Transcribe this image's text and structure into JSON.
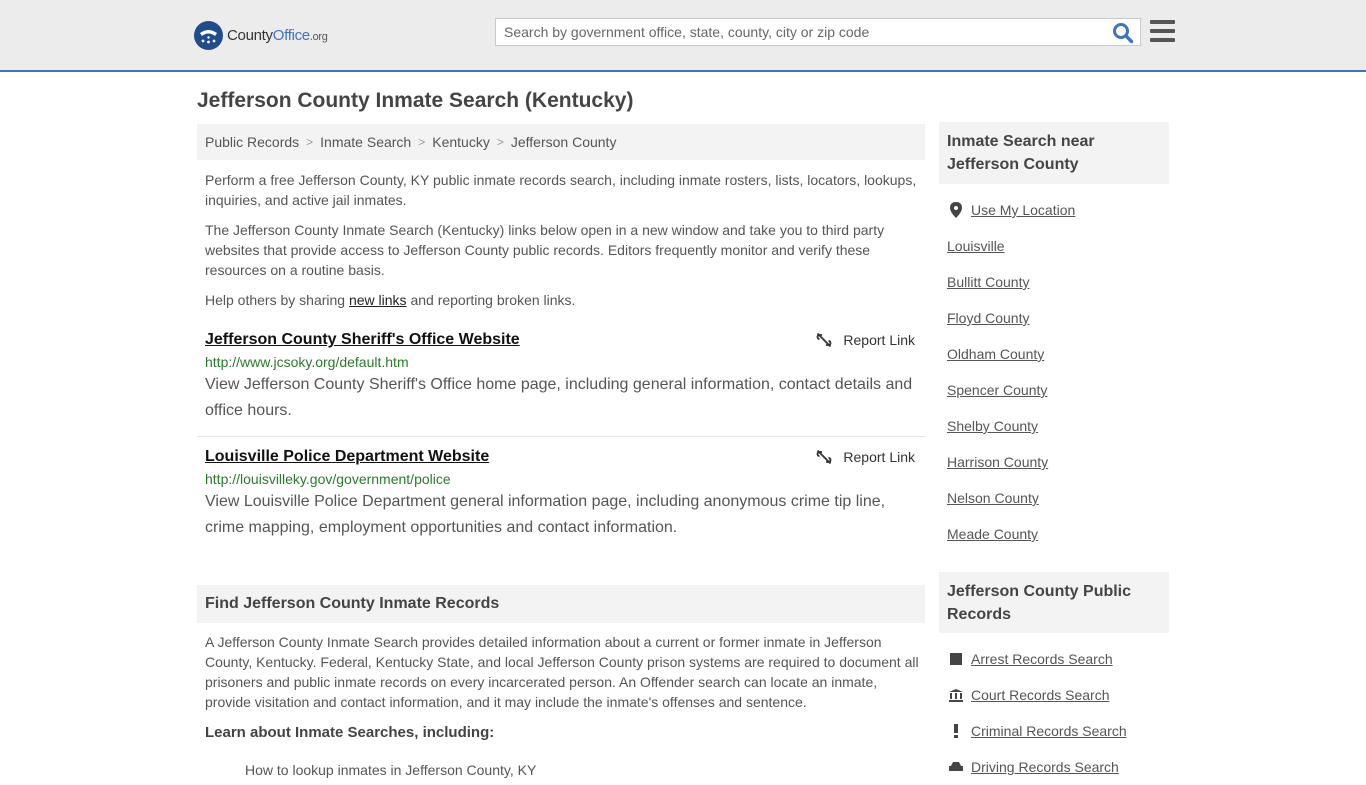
{
  "header": {
    "logo_prefix": "County",
    "logo_highlight": "Office",
    "logo_tld": ".org",
    "search_placeholder": "Search by government office, state, county, city or zip code"
  },
  "page": {
    "title": "Jefferson County Inmate Search (Kentucky)"
  },
  "breadcrumb": [
    "Public Records",
    "Inmate Search",
    "Kentucky",
    "Jefferson County"
  ],
  "intro": {
    "p1": "Perform a free Jefferson County, KY public inmate records search, including inmate rosters, lists, locators, lookups, inquiries, and active jail inmates.",
    "p2": "The Jefferson County Inmate Search (Kentucky) links below open in a new window and take you to third party websites that provide access to Jefferson County public records. Editors frequently monitor and verify these resources on a routine basis.",
    "p3_before": "Help others by sharing ",
    "p3_link": "new links",
    "p3_after": " and reporting broken links."
  },
  "links": [
    {
      "title": "Jefferson County Sheriff's Office Website",
      "url": "http://www.jcsoky.org/default.htm",
      "description": "View Jefferson County Sheriff's Office home page, including general information, contact details and office hours.",
      "report_label": "Report Link"
    },
    {
      "title": "Louisville Police Department Website",
      "url": "http://louisvilleky.gov/government/police",
      "description": "View Louisville Police Department general information page, including anonymous crime tip line, crime mapping, employment opportunities and contact information.",
      "report_label": "Report Link"
    }
  ],
  "find_section": {
    "heading": "Find Jefferson County Inmate Records",
    "body": "A Jefferson County Inmate Search provides detailed information about a current or former inmate in Jefferson County, Kentucky. Federal, Kentucky State, and local Jefferson County prison systems are required to document all prisoners and public inmate records on every incarcerated person. An Offender search can locate an inmate, provide visitation and contact information, and it may include the inmate's offenses and sentence.",
    "learn_heading": "Learn about Inmate Searches, including:",
    "cut_item": "How to lookup inmates in Jefferson County, KY"
  },
  "sidebar": {
    "nearby_heading": "Inmate Search near Jefferson County",
    "nearby_items": [
      "Use My Location",
      "Louisville",
      "Bullitt County",
      "Floyd County",
      "Oldham County",
      "Spencer County",
      "Shelby County",
      "Harrison County",
      "Nelson County",
      "Meade County"
    ],
    "records_heading": "Jefferson County Public Records",
    "records_items": [
      {
        "label": "Arrest Records Search",
        "icon": "square-icon"
      },
      {
        "label": "Court Records Search",
        "icon": "courthouse-icon"
      },
      {
        "label": "Criminal Records Search",
        "icon": "exclamation-icon"
      },
      {
        "label": "Driving Records Search",
        "icon": "car-icon"
      }
    ]
  },
  "colors": {
    "accent_blue": "#3f74c0",
    "url_green": "#2b7a2b",
    "panel_gray": "#f3f3f3"
  }
}
